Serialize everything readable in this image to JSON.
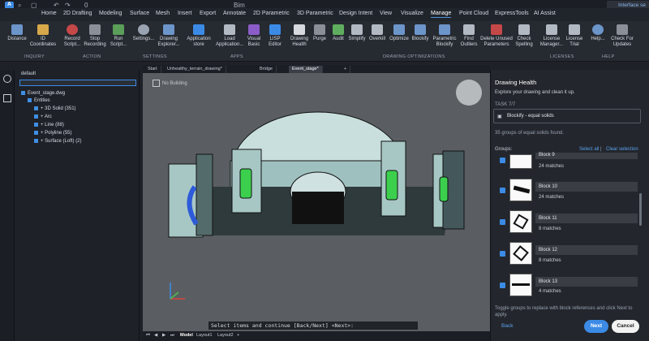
{
  "titlebar": {
    "file": "Bim",
    "counter": "0",
    "right_text": "Interface se"
  },
  "menu": [
    "Home",
    "2D Drafting",
    "Modeling",
    "Surface",
    "Mesh",
    "Insert",
    "Export",
    "Annotate",
    "2D Parametric",
    "3D Parametric",
    "Design Intent",
    "View",
    "Visualize",
    "Manage",
    "Point Cloud",
    "ExpressTools",
    "AI Assist"
  ],
  "ribbon": {
    "buttons": [
      "Distance",
      "ID Coordinates",
      "Record Script...",
      "Stop Recording",
      "Run Script...",
      "Settings...",
      "Drawing Explorer...",
      "Application store",
      "Load Application...",
      "Visual Basic",
      "LISP Editor",
      "Drawing Health",
      "Purge",
      "Audit",
      "Simplify",
      "Overkill",
      "Optimize",
      "Blockify",
      "Parametric Blockify",
      "Find Outliers",
      "Delete Unused Parameters",
      "Check Spelling",
      "License Manager...",
      "License Trial",
      "Help...",
      "Check For Updates"
    ],
    "groups": [
      "INQUIRY",
      "ACTION",
      "SETTINGS",
      "APPS",
      "DRAWING OPTIMIZATIONS",
      "LICENSES",
      "HELP"
    ]
  },
  "left_panel": {
    "layer": "default",
    "file": "Event_stage.dwg",
    "entities_label": "Entities",
    "items": [
      "3D Solid (351)",
      "Arc",
      "Line (88)",
      "Polyline (55)",
      "Surface (Loft) (2)"
    ]
  },
  "tabs": [
    "Start",
    "Unhealthy_terrain_drawing*",
    "Bridge",
    "Event_stage*"
  ],
  "viewport": {
    "view_label": "No Building",
    "command": "Select items and continue [Back/Next] <Next>:"
  },
  "layout_tabs": [
    "Model",
    "Layout1",
    "Layout2"
  ],
  "right_panel": {
    "title": "Drawing Health",
    "subtitle": "Explore your drawing and clean it up.",
    "task": "TASK 7/7",
    "task_name": "Blockify - equal solids",
    "found": "35 groups of equal solids found.",
    "groups_label": "Groups:",
    "select_all": "Select all",
    "clear_selection": "Clear selection",
    "blocks": [
      {
        "name": "Block 9",
        "matches": "24 matches"
      },
      {
        "name": "Block 10",
        "matches": "24 matches"
      },
      {
        "name": "Block 11",
        "matches": "8 matches"
      },
      {
        "name": "Block 12",
        "matches": "8 matches"
      },
      {
        "name": "Block 13",
        "matches": "4 matches"
      }
    ],
    "footer": "Toggle groups to replace with block references and click Next to apply.",
    "back": "Back",
    "next": "Next",
    "cancel": "Cancel"
  },
  "colors": {
    "accent": "#3b8be6",
    "green": "#3ccf4e"
  }
}
